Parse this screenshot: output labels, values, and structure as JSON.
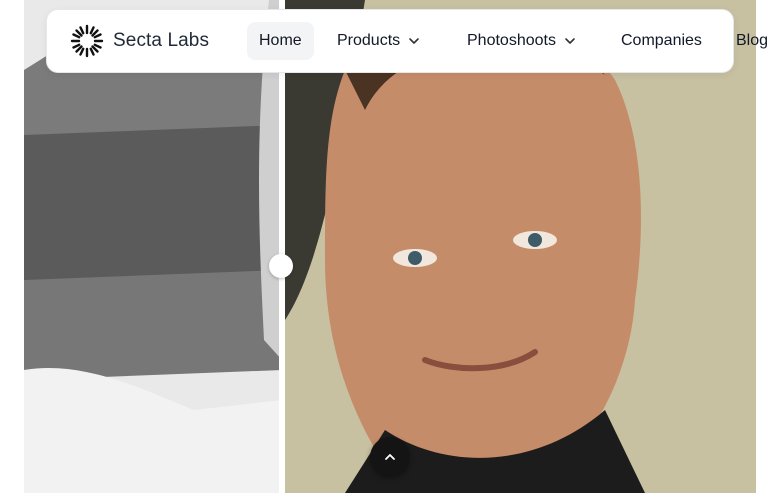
{
  "brand": {
    "name": "Secta Labs",
    "icon": "sun-burst-logo-icon"
  },
  "nav": {
    "home": "Home",
    "products": "Products",
    "photoshoots": "Photoshoots",
    "companies": "Companies",
    "blog": "Blog"
  },
  "icons": {
    "chevron": "chevron-down-icon",
    "to_top": "chevron-up-icon"
  },
  "colors": {
    "button_dark": "#141414",
    "active_nav_bg": "#f3f4f6",
    "text": "#111827"
  },
  "comparison": {
    "before_label": "",
    "after_label": ""
  }
}
